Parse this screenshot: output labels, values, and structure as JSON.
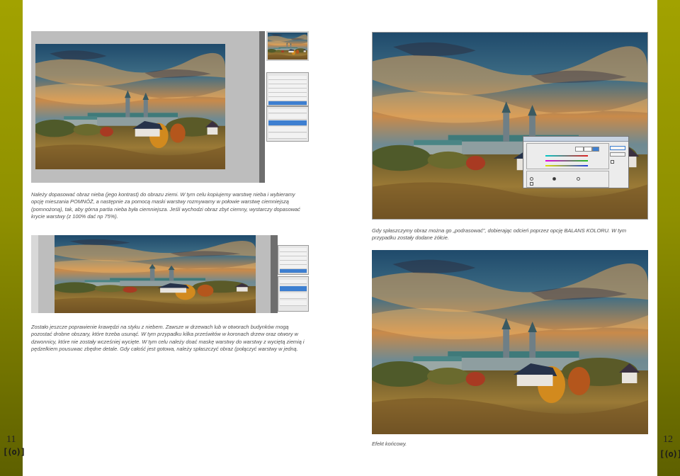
{
  "pages": {
    "left_number": "11",
    "right_number": "12",
    "logo_text": "[(o)]"
  },
  "captions": {
    "top_left": "Należy dopasować obraz nieba (jego kontrast) do obrazu ziemi. W tym celu kopiujemy warstwę nieba i wybieramy opcję mieszania POMNÓŻ, a następnie za pomocą maski warstwy rozmywamy w połowie warstwę ciemniejszą (pomnożoną), tak, aby górna partia nieba była ciemniejsza. Jeśli wychodzi obraz zbyt ciemny, wystarczy dopasować krycie warstwy (z 100% dać np 75%).",
    "bottom_left": "Zostało jeszcze poprawienie krawędzi na styku z niebem. Zawsze w drzewach lub w otworach budynków mogą pozostać drobne obszary, które trzeba usunąć. W tym przypadku kilka prześwitów w koronach drzew oraz otwory w dzwonnicy, które nie zostały wcześniej wycięte. W tym celu należy doać maskę warstwy do warstwy z wyciętą ziemią i pędzelkiem pousuwac zbędne detale. Gdy całość jest gotowa, należy spłaszczyć obraz (połączyć warstwy w jedną.",
    "top_right": "Gdy spłaszczymy obraz można go „podrasować”, dobierając odcień poprzez opcję BALANS KOLORU. W tym przypadku zostały dodane żółcie.",
    "bottom_right": "Efekt końcowy."
  },
  "colors": {
    "side_bar": "#8f9000",
    "caption": "#4d4d4d",
    "selected_layer": "#3d7fd1"
  },
  "icons": {
    "logo": "radio-waves-icon"
  }
}
